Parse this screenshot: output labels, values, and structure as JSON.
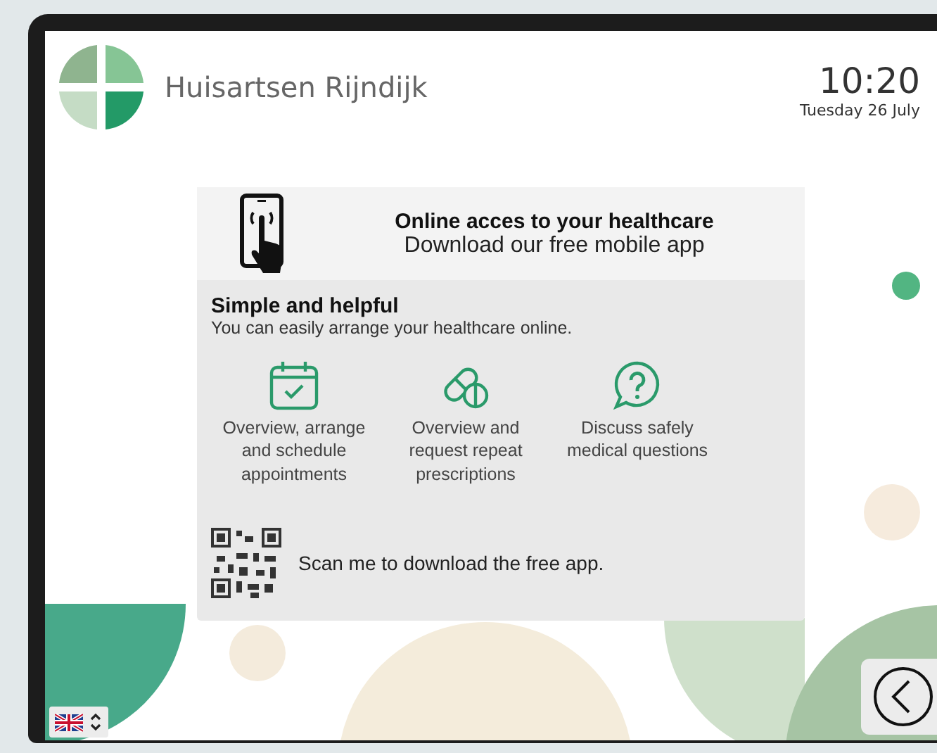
{
  "header": {
    "practice_name": "Huisartsen Rijndijk",
    "time": "10:20",
    "date": "Tuesday 26 July"
  },
  "card": {
    "title": "Online acces to your healthcare",
    "subtitle": "Download our free mobile app",
    "heading": "Simple and helpful",
    "intro": "You can easily arrange your healthcare online.",
    "features": [
      {
        "kind": "calendar",
        "text": "Overview, arrange and schedule appointments"
      },
      {
        "kind": "pills",
        "text": "Overview and request repeat prescriptions"
      },
      {
        "kind": "question",
        "text": "Discuss safely medical questions"
      }
    ],
    "qr_text": "Scan me to download the free app."
  }
}
